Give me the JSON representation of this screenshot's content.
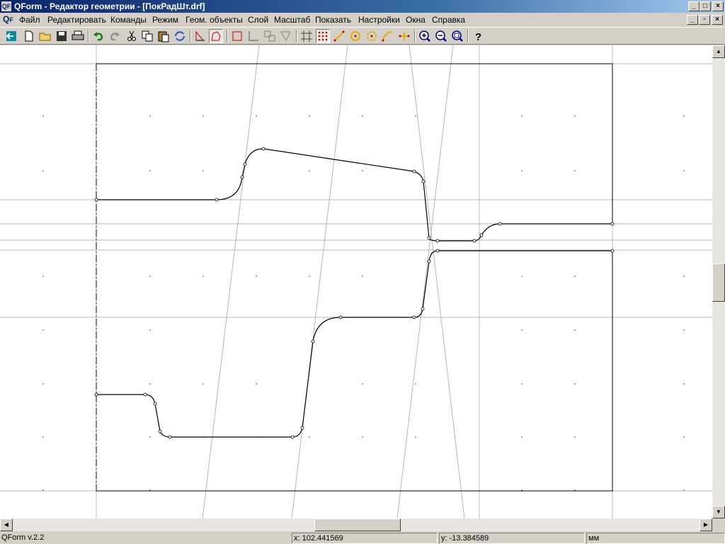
{
  "window": {
    "title": "QForm - Редактор геометрии  - [ПокРадШт.drf]",
    "app_icon": "qf-logo",
    "controls": [
      "minimize-icon",
      "maximize-icon",
      "close-icon"
    ],
    "child_controls": [
      "minimize-icon",
      "restore-icon",
      "close-icon"
    ]
  },
  "menu": {
    "items": [
      {
        "label": "Файл"
      },
      {
        "label": "Редактировать"
      },
      {
        "label": "Команды"
      },
      {
        "label": "Режим"
      },
      {
        "label": "Геом. объекты"
      },
      {
        "label": "Слой"
      },
      {
        "label": "Масштаб"
      },
      {
        "label": "Показать"
      },
      {
        "label": "Настройки"
      },
      {
        "label": "Окна"
      },
      {
        "label": "Справка"
      }
    ]
  },
  "toolbar": {
    "buttons": [
      "exit-icon",
      "new-file-icon",
      "open-folder-icon",
      "save-icon",
      "print-icon",
      "undo-icon",
      "redo-icon",
      "cut-icon",
      "copy-icon",
      "paste-icon",
      "refresh-icon",
      "region-icon",
      "region-pressed-icon",
      "rectangle-icon",
      "angle-icon",
      "snap-copy-icon",
      "snap-arrow-icon",
      "grid-lines-icon",
      "snap-points-icon",
      "snap-line-icon",
      "snap-circle-icon",
      "snap-center-icon",
      "snap-arc-icon",
      "snap-end-icon",
      "zoom-in-icon",
      "zoom-out-icon",
      "zoom-fit-icon",
      "help-icon"
    ]
  },
  "colors": {
    "title_gradient_start": "#0a246a",
    "title_gradient_end": "#a6caf0",
    "face": "#d4d0c8",
    "canvas": "#ffffff",
    "grid_line": "#b4b4c8"
  },
  "status": {
    "version": "QForm v.2.2",
    "x_coord": "x: 102.441569",
    "y_coord": "y: -13.384589",
    "units": "мм"
  }
}
